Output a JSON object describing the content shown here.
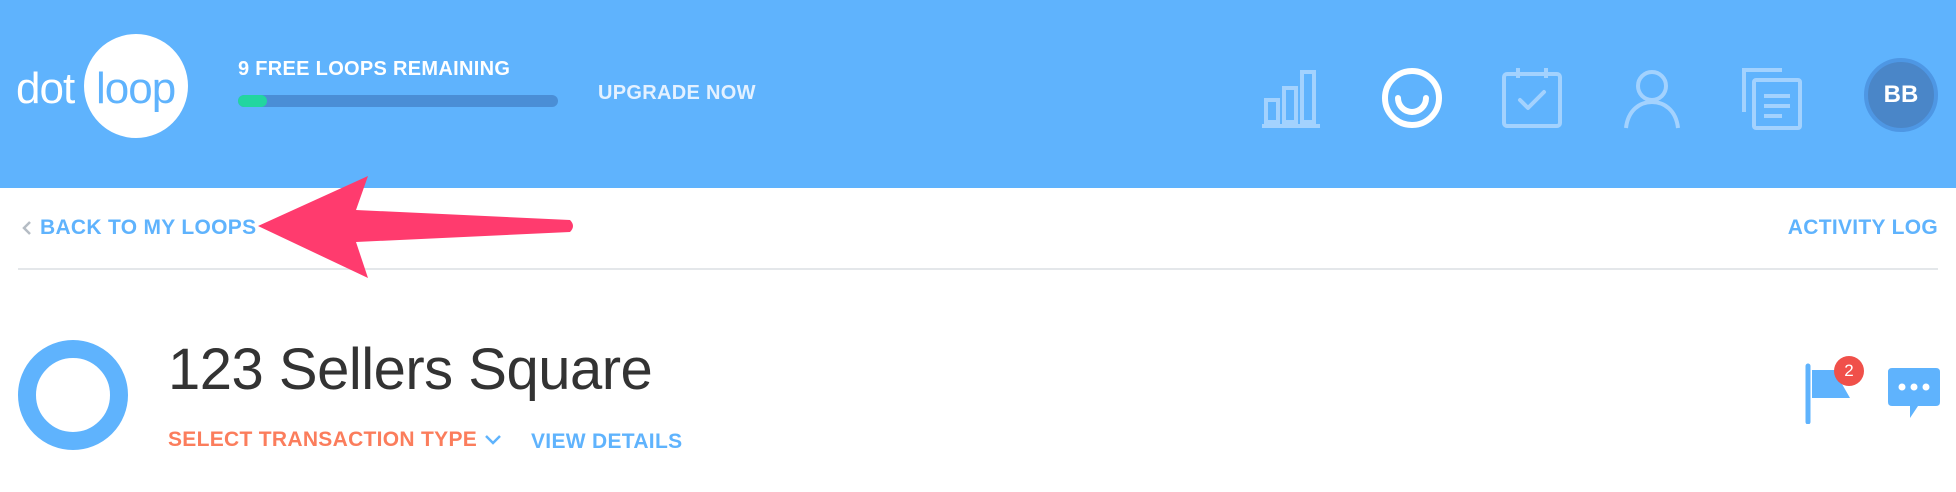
{
  "brand": {
    "dot": "dot",
    "loop": "loop"
  },
  "header": {
    "free_loops_label": "9 FREE LOOPS REMAINING",
    "free_loops_progress": 0.09,
    "upgrade_label": "UPGRADE NOW",
    "nav_icons": [
      "bar-chart-icon",
      "smile-icon",
      "task-checklist-icon",
      "person-icon",
      "documents-icon"
    ],
    "avatar_initials": "BB"
  },
  "subnav": {
    "back_label": "BACK TO MY LOOPS",
    "activity_label": "ACTIVITY LOG"
  },
  "loop": {
    "title": "123 Sellers Square",
    "transaction_type_label": "SELECT TRANSACTION TYPE",
    "view_details_label": "VIEW DETAILS",
    "flag_count": "2"
  },
  "colors": {
    "header_bg": "#5fb3fd",
    "accent_blue": "#5fb3fd",
    "progress_fill": "#22d6a0",
    "transaction_orange": "#fb7d5c",
    "annotation_arrow": "#ff3b6e",
    "badge_red": "#f0504a"
  }
}
